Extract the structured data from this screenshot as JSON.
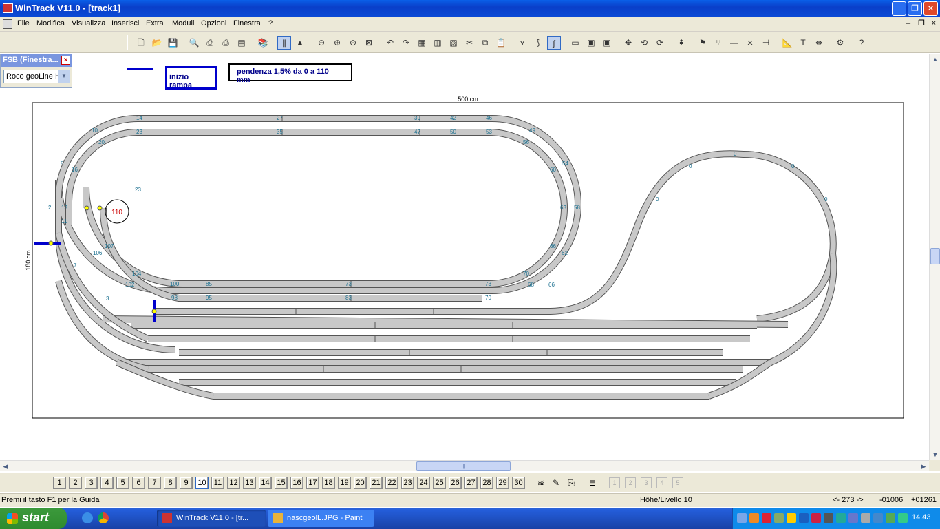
{
  "window": {
    "title": "WinTrack  V11.0 - [track1]"
  },
  "menu": [
    "File",
    "Modifica",
    "Visualizza",
    "Inserisci",
    "Extra",
    "Moduli",
    "Opzioni",
    "Finestra",
    "?"
  ],
  "fsb": {
    "title": "FSB (Finestra...",
    "library": "Roco geoLine H"
  },
  "annotations": {
    "ramp_start": "inizio rampa",
    "slope": "pendenza 1,5% da 0 a 110 mm"
  },
  "drawing": {
    "width_label": "500 cm",
    "height_label": "180 cm",
    "height_marker": "110",
    "colors": {
      "track_fill": "#c8c8c8",
      "track_edge": "#555555",
      "label": "#1a6f8f",
      "marker": "#0000cc"
    },
    "outer_loop_labels": [
      "14",
      "27",
      "39",
      "42",
      "46",
      "10",
      "49",
      "8",
      "54",
      "2",
      "58",
      "62",
      "7",
      "66",
      "3",
      "0",
      "73",
      "85",
      "100",
      "70"
    ],
    "inner_loop_labels": [
      "23",
      "35",
      "47",
      "50",
      "53",
      "20",
      "56",
      "16",
      "60",
      "13",
      "63",
      "11",
      "66",
      "106",
      "107",
      "104",
      "102",
      "98",
      "95",
      "83",
      "70",
      "68",
      "100",
      "110"
    ],
    "yard_labels": [
      "0",
      "0",
      "0",
      "0",
      "0"
    ]
  },
  "layers": [
    "1",
    "2",
    "3",
    "4",
    "5",
    "6",
    "7",
    "8",
    "9",
    "10",
    "11",
    "12",
    "13",
    "14",
    "15",
    "16",
    "17",
    "18",
    "19",
    "20",
    "21",
    "22",
    "23",
    "24",
    "25",
    "26",
    "27",
    "28",
    "29",
    "30"
  ],
  "status": {
    "help": "Premi il tasto F1 per la Guida",
    "level": "Höhe/Livello 10",
    "angle": "<- 273 ->",
    "x": "-01006",
    "y": "+01261"
  },
  "taskbar": {
    "start": "start",
    "tasks": [
      "WinTrack  V11.0 - [tr...",
      "nascgeolL.JPG - Paint"
    ],
    "clock": "14.43"
  }
}
